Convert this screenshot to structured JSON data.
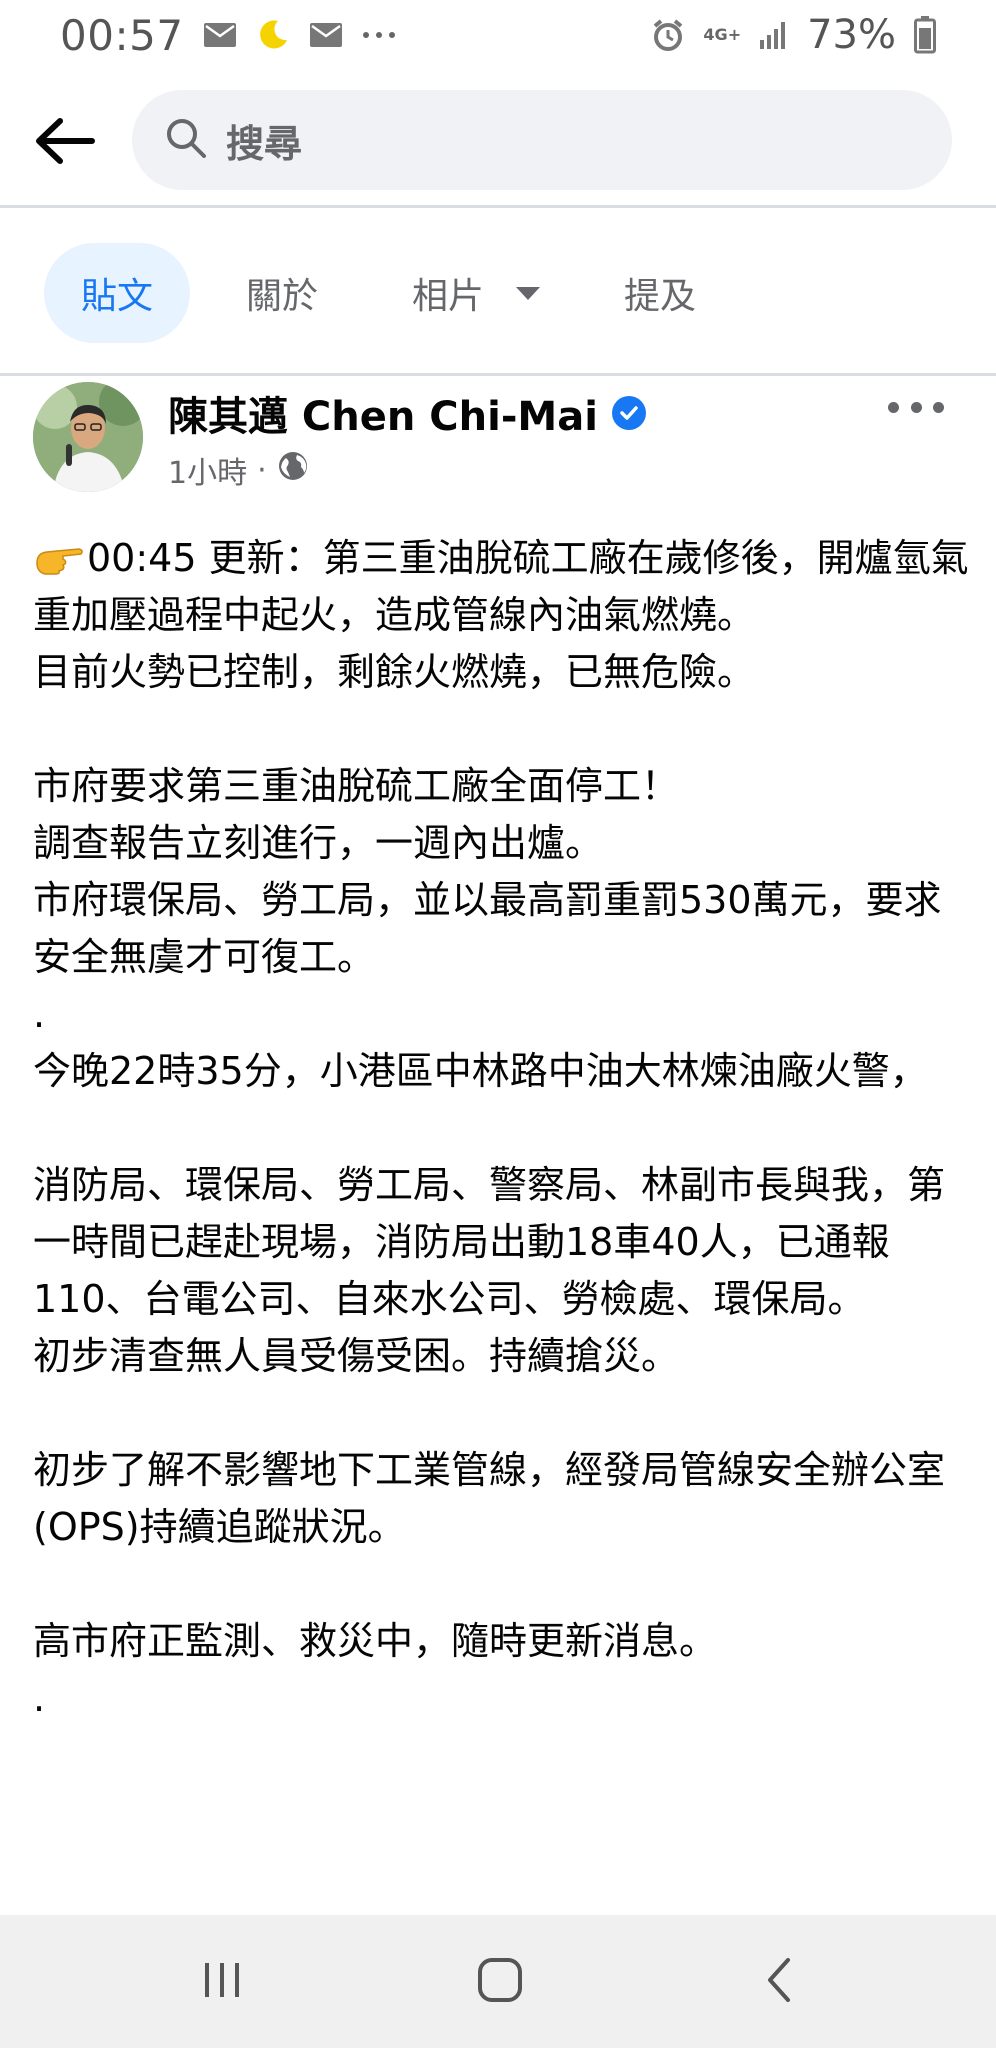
{
  "status_bar": {
    "time": "00:57",
    "network": "4G+",
    "battery": "73%",
    "icons": [
      "mail-icon",
      "moon-icon",
      "mail-icon",
      "more-notifications-icon",
      "alarm-icon",
      "network-icon",
      "signal-icon",
      "battery-icon"
    ]
  },
  "header": {
    "back_icon": "back-arrow-icon",
    "search_placeholder": "搜尋"
  },
  "tabs": [
    {
      "label": "貼文",
      "active": true
    },
    {
      "label": "關於",
      "active": false
    },
    {
      "label": "相片",
      "active": false,
      "has_dropdown": true
    },
    {
      "label": "提及",
      "active": false
    }
  ],
  "post": {
    "author": "陳其邁 Chen Chi-Mai",
    "verified": true,
    "time": "1小時",
    "separator": "·",
    "audience_icon": "globe-icon",
    "paragraphs": [
      "00:45 更新：第三重油脫硫工廠在歲修後，開爐氫氣重加壓過程中起火，造成管線內油氣燃燒。\n目前火勢已控制，剩餘火燃燒，已無危險。",
      "市府要求第三重油脫硫工廠全面停工！\n調查報告立刻進行，一週內出爐。\n市府環保局、勞工局，並以最高罰重罰530萬元，要求安全無虞才可復工。\n.\n今晚22時35分，小港區中林路中油大林煉油廠火警，",
      "消防局、環保局、勞工局、警察局、林副市長與我，第一時間已趕赴現場，消防局出動18車40人，已通報110、台電公司、自來水公司、勞檢處、環保局。\n初步清查無人員受傷受困。持續搶災。",
      "初步了解不影響地下工業管線，經發局管線安全辦公室(OPS)持續追蹤狀況。",
      "高市府正監測、救災中，隨時更新消息。\n."
    ]
  },
  "nav": {
    "recent_icon": "recent-apps-icon",
    "home_icon": "home-icon",
    "back_icon": "nav-back-icon"
  },
  "colors": {
    "accent": "#1877f2",
    "tab_active_bg": "#e7f3ff",
    "secondary_text": "#65676b"
  }
}
